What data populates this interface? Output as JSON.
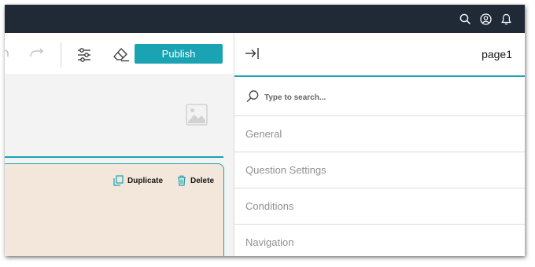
{
  "toolbar": {
    "publish_label": "Publish"
  },
  "card": {
    "duplicate_label": "Duplicate",
    "delete_label": "Delete"
  },
  "panel": {
    "title": "page1",
    "search_placeholder": "Type to search...",
    "sections": [
      {
        "label": "General"
      },
      {
        "label": "Question Settings"
      },
      {
        "label": "Conditions"
      },
      {
        "label": "Navigation"
      }
    ]
  },
  "colors": {
    "accent": "#19a3b3",
    "topbar": "#1f2a36",
    "card_background": "#f3e6da"
  },
  "icons": {
    "topbar": [
      "search-icon",
      "user-icon",
      "bell-icon"
    ],
    "toolbar": [
      "undo-icon",
      "redo-icon",
      "settings-sliders-icon",
      "eraser-icon"
    ]
  }
}
